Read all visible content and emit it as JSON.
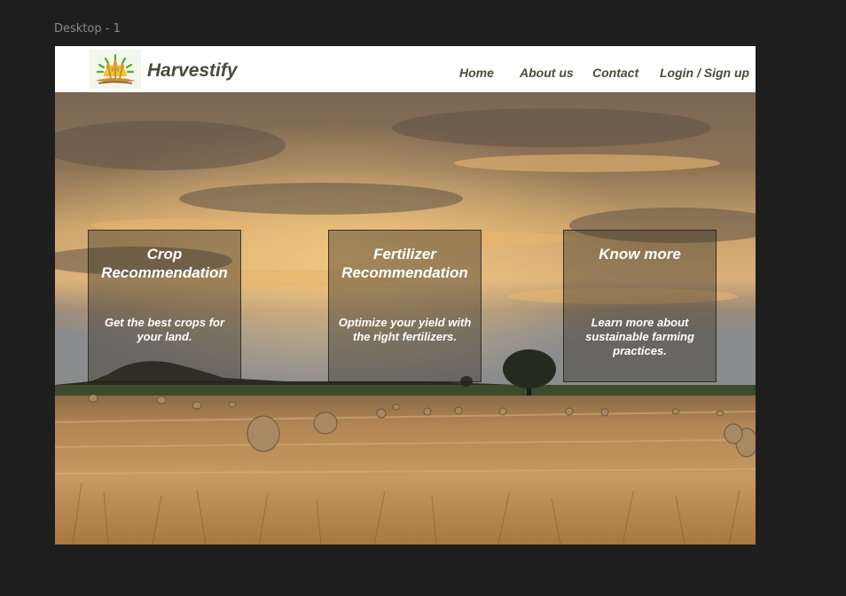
{
  "canvas": {
    "frame_label": "Desktop - 1"
  },
  "navbar": {
    "brand": "Harvestify",
    "links": [
      {
        "label": "Home"
      },
      {
        "label": "About us"
      },
      {
        "label": "Contact"
      },
      {
        "label": "Login / Sign up"
      }
    ]
  },
  "hero": {
    "image": "sunset-wheat-field-with-hay-bales"
  },
  "cards": [
    {
      "title": "Crop Recommendation",
      "text": "Get the best crops for your land."
    },
    {
      "title": "Fertilizer Recommendation",
      "text": "Optimize your yield with the right fertilizers."
    },
    {
      "title": "Know more",
      "text": "Learn more about sustainable farming practices."
    }
  ]
}
